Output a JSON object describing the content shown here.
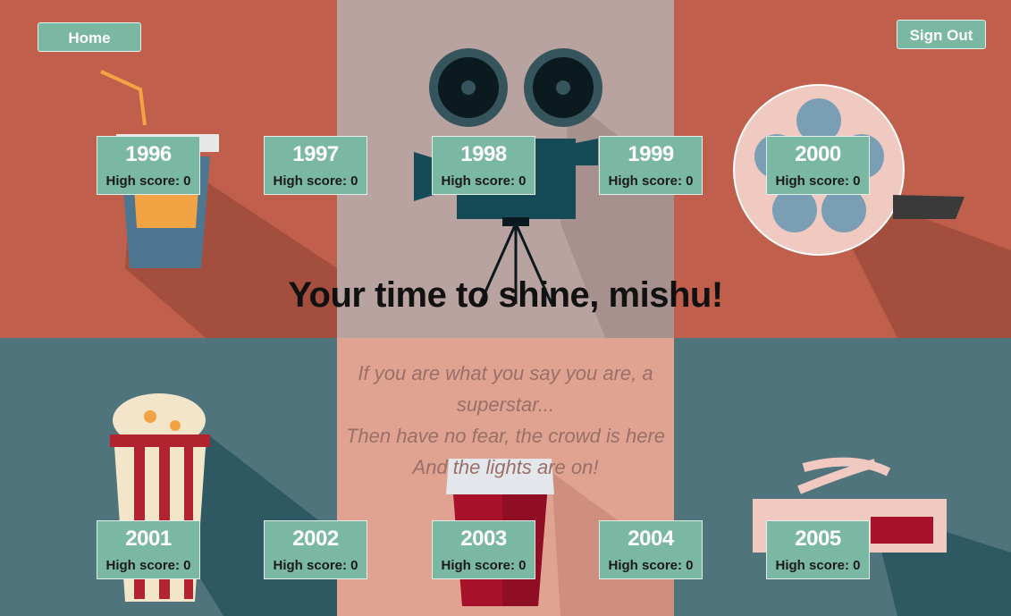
{
  "nav": {
    "home_label": "Home",
    "signout_label": "Sign Out"
  },
  "headline": "Your time to shine, mishu!",
  "quote_lines": [
    "If you are what you say you are, a superstar...",
    "Then have no fear, the crowd is here",
    "And the lights are on!"
  ],
  "years": [
    {
      "year": "1996",
      "high_score": "High score: 0"
    },
    {
      "year": "1997",
      "high_score": "High score: 0"
    },
    {
      "year": "1998",
      "high_score": "High score: 0"
    },
    {
      "year": "1999",
      "high_score": "High score: 0"
    },
    {
      "year": "2000",
      "high_score": "High score: 0"
    },
    {
      "year": "2001",
      "high_score": "High score: 0"
    },
    {
      "year": "2002",
      "high_score": "High score: 0"
    },
    {
      "year": "2003",
      "high_score": "High score: 0"
    },
    {
      "year": "2004",
      "high_score": "High score: 0"
    },
    {
      "year": "2005",
      "high_score": "High score: 0"
    }
  ],
  "colors": {
    "panel_rust": "#c05f4c",
    "panel_mauve": "#b8a3a0",
    "panel_teal": "#4f747c",
    "panel_salmon": "#e0a391",
    "button_green": "#7bb8a3"
  }
}
